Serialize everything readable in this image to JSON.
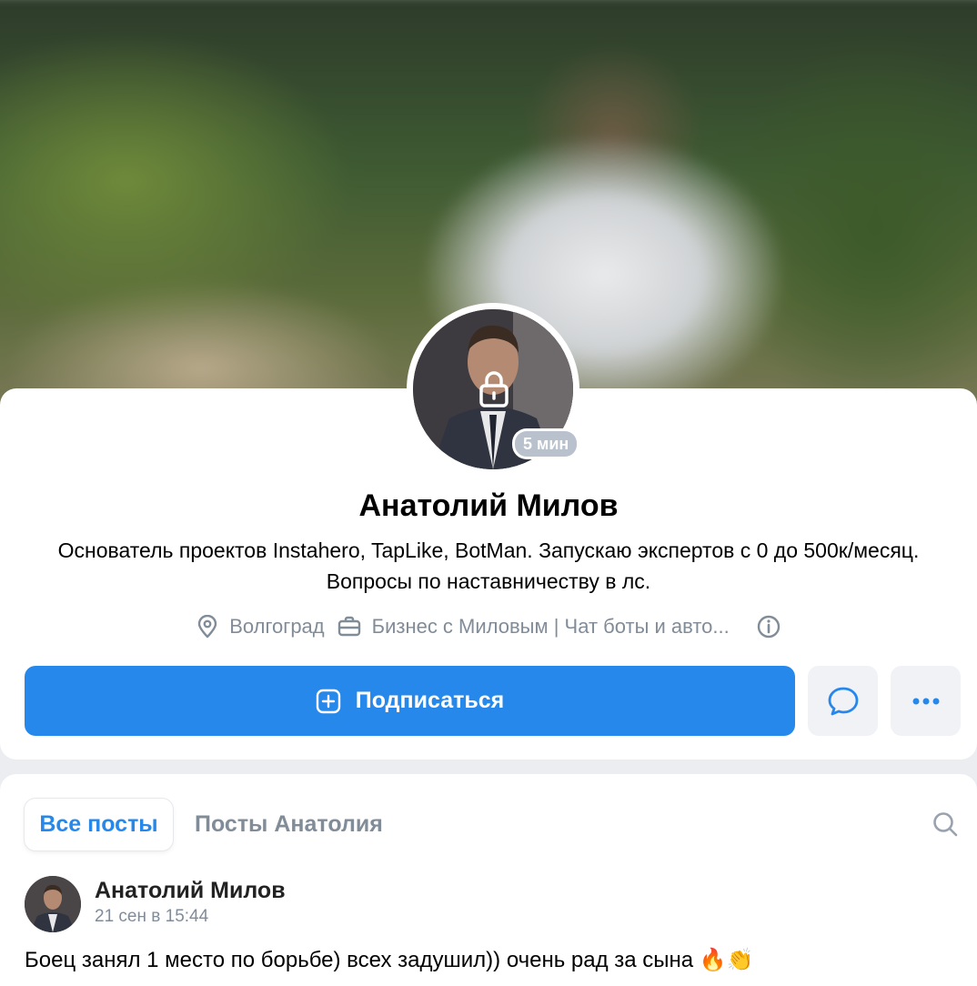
{
  "profile": {
    "name": "Анатолий Милов",
    "online_status": "5 мин",
    "bio": "Основатель проектов Instahero, TapLike, BotMan. Запускаю экспертов с 0 до 500к/месяц. Вопросы по наставничеству в лс.",
    "city": "Волгоград",
    "work": "Бизнес с Миловым | Чат боты и авто...",
    "subscribe_label": "Подписаться",
    "accent_color": "#2688eb"
  },
  "tabs": [
    {
      "label": "Все посты",
      "active": true
    },
    {
      "label": "Посты Анатолия",
      "active": false
    }
  ],
  "post": {
    "author": "Анатолий Милов",
    "date": "21 сен в 15:44",
    "text": "Боец занял 1 место по борьбе) всех задушил)) очень рад за сына",
    "emoji": "🔥👏"
  },
  "icons": [
    "lock-icon",
    "location-icon",
    "briefcase-icon",
    "info-icon",
    "plus-square-icon",
    "message-icon",
    "more-icon",
    "search-icon"
  ]
}
